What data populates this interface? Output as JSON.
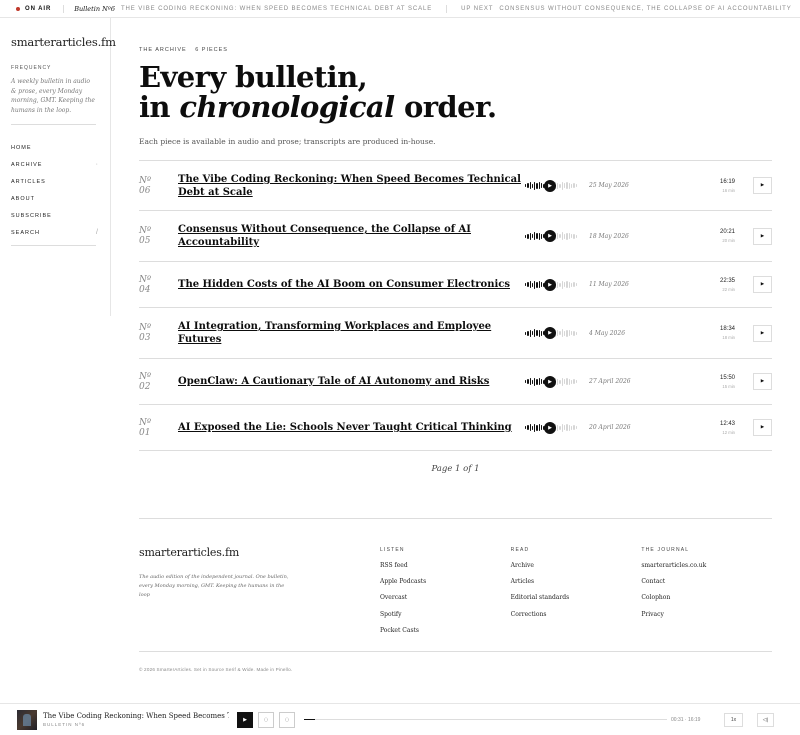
{
  "ticker": {
    "on_air": "ON AIR",
    "bulletin": "Bulletin Nº6",
    "now_title": "THE VIBE CODING RECKONING: WHEN SPEED BECOMES TECHNICAL DEBT AT SCALE",
    "up_next_label": "UP NEXT",
    "up_next_title": "CONSENSUS WITHOUT CONSEQUENCE, THE COLLAPSE OF AI ACCOUNTABILITY"
  },
  "sidebar": {
    "brand": "smarterarticles.fm",
    "frequency_label": "FREQUENCY",
    "frequency_text": "A weekly bulletin in audio & prose, every Monday morning, GMT. Keeping the humans in the loop.",
    "nav": [
      {
        "label": "HOME",
        "tail": ""
      },
      {
        "label": "ARCHIVE",
        "tail": "·"
      },
      {
        "label": "ARTICLES",
        "tail": ""
      },
      {
        "label": "ABOUT",
        "tail": ""
      },
      {
        "label": "SUBSCRIBE",
        "tail": ""
      },
      {
        "label": "SEARCH",
        "tail": "/"
      }
    ]
  },
  "main": {
    "kicker_a": "THE ARCHIVE",
    "kicker_b": "6 PIECES",
    "headline_1": "Every bulletin,",
    "headline_2a": "in ",
    "headline_2b": "chronological",
    "headline_2c": " order.",
    "intro": "Each piece is available in audio and prose; transcripts are produced in-house.",
    "episodes": [
      {
        "no": "Nº",
        "num": "06",
        "title": "The Vibe Coding Reckoning: When Speed Becomes Technical Debt at Scale",
        "date": "25 May 2026",
        "time": "16:19",
        "mins": "16 min",
        "progress": 0.45
      },
      {
        "no": "Nº",
        "num": "05",
        "title": "Consensus Without Consequence, the Collapse of AI Accountability",
        "date": "18 May 2026",
        "time": "20:21",
        "mins": "20 min",
        "progress": 0.4
      },
      {
        "no": "Nº",
        "num": "04",
        "title": "The Hidden Costs of the AI Boom on Consumer Electronics",
        "date": "11 May 2026",
        "time": "22:35",
        "mins": "22 min",
        "progress": 0.4
      },
      {
        "no": "Nº",
        "num": "03",
        "title": "AI Integration, Transforming Workplaces and Employee Futures",
        "date": "4 May 2026",
        "time": "18:34",
        "mins": "18 min",
        "progress": 0.4
      },
      {
        "no": "Nº",
        "num": "02",
        "title": "OpenClaw: A Cautionary Tale of AI Autonomy and Risks",
        "date": "27 April 2026",
        "time": "15:50",
        "mins": "15 min",
        "progress": 0.4
      },
      {
        "no": "Nº",
        "num": "01",
        "title": "AI Exposed the Lie: Schools Never Taught Critical Thinking",
        "date": "20 April 2026",
        "time": "12:43",
        "mins": "12 min",
        "progress": 0.4
      }
    ],
    "pager": "Page 1 of 1"
  },
  "footer": {
    "brand": "smarterarticles.fm",
    "desc": "The audio edition of the independent journal. One bulletin, every Monday morning, GMT. Keeping the humans in the loop",
    "cols": [
      {
        "heading": "LISTEN",
        "links": [
          "RSS feed",
          "Apple Podcasts",
          "Overcast",
          "Spotify",
          "Pocket Casts"
        ]
      },
      {
        "heading": "READ",
        "links": [
          "Archive",
          "Articles",
          "Editorial standards",
          "Corrections"
        ]
      },
      {
        "heading": "THE JOURNAL",
        "links": [
          "smarterarticles.co.uk",
          "Contact",
          "Colophon",
          "Privacy"
        ]
      }
    ],
    "copyright": "© 2026 SmarterArticles. Set in Source Serif & Wide. Made in Pinello."
  },
  "player": {
    "title": "The Vibe Coding Reckoning: When Speed Becomes Tec...",
    "bulletin": "BULLETIN Nº6",
    "time": "00:31 · 16:19",
    "speed": "1x",
    "progress": 0.03
  }
}
